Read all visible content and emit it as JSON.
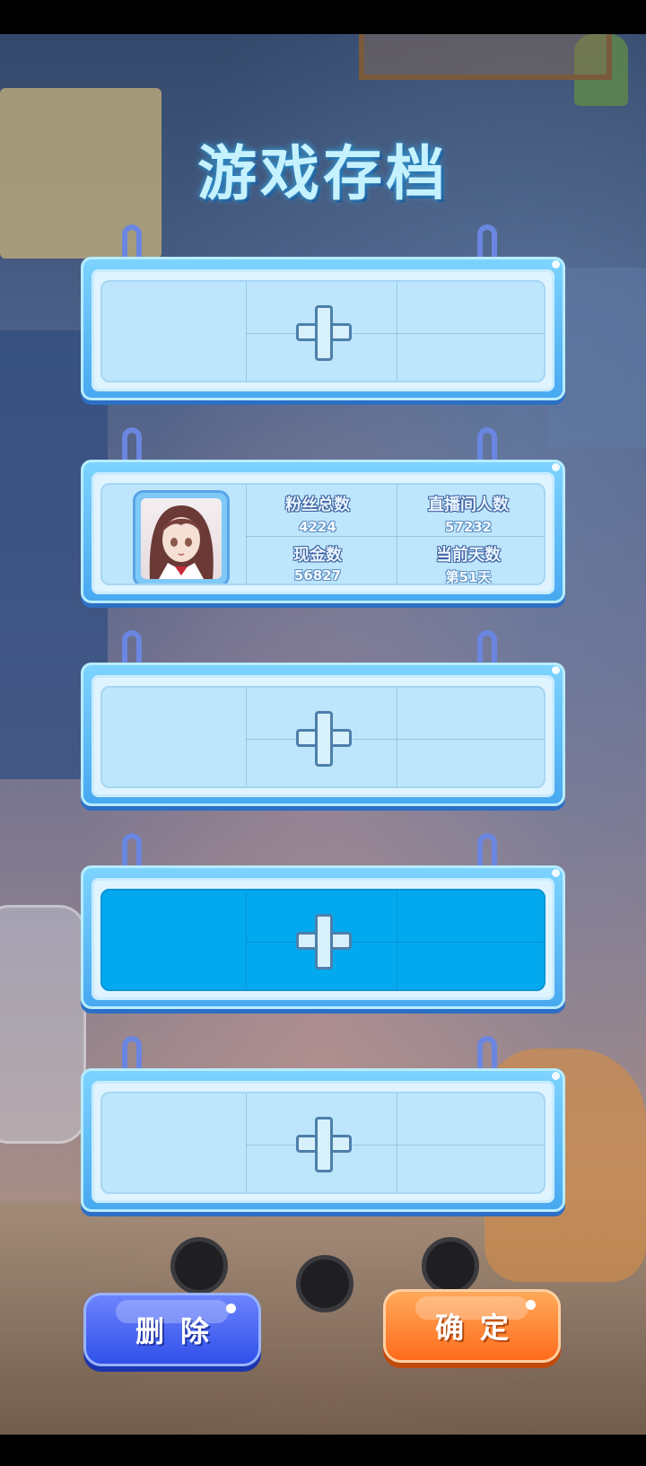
{
  "page": {
    "title": "游戏存档"
  },
  "slots": [
    {
      "type": "empty",
      "icon": "plus-icon"
    },
    {
      "type": "filled",
      "avatar": "anime-girl-avatar",
      "stats": {
        "fans_label": "粉丝总数",
        "fans_value": "4224",
        "viewers_label": "直播间人数",
        "viewers_value": "57232",
        "cash_label": "现金数",
        "cash_value": "56827",
        "day_label": "当前天数",
        "day_value": "第51天"
      }
    },
    {
      "type": "empty",
      "icon": "plus-icon"
    },
    {
      "type": "empty",
      "icon": "plus-icon",
      "selected": true
    },
    {
      "type": "empty",
      "icon": "plus-icon"
    }
  ],
  "buttons": {
    "delete": "删除",
    "confirm": "确定"
  },
  "colors": {
    "selected_slot": "#03a9ef",
    "delete_button": "#2d4ee8",
    "confirm_button": "#ff6a1a"
  }
}
